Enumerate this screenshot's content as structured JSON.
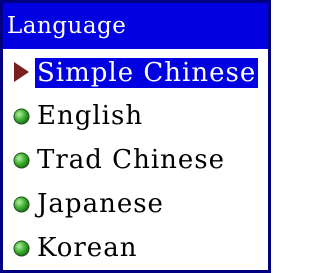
{
  "menu": {
    "title": "Language",
    "items": [
      {
        "label": "Simple Chinese",
        "selected": true,
        "icon": "selected-arrow-icon"
      },
      {
        "label": "English",
        "selected": false,
        "icon": "green-bullet-icon"
      },
      {
        "label": "Trad Chinese",
        "selected": false,
        "icon": "green-bullet-icon"
      },
      {
        "label": "Japanese",
        "selected": false,
        "icon": "green-bullet-icon"
      },
      {
        "label": "Korean",
        "selected": false,
        "icon": "green-bullet-icon"
      }
    ]
  },
  "colors": {
    "highlight": "#0000e0",
    "border": "#000080",
    "arrow": "#7a2020",
    "bullet": "#3cb030"
  }
}
